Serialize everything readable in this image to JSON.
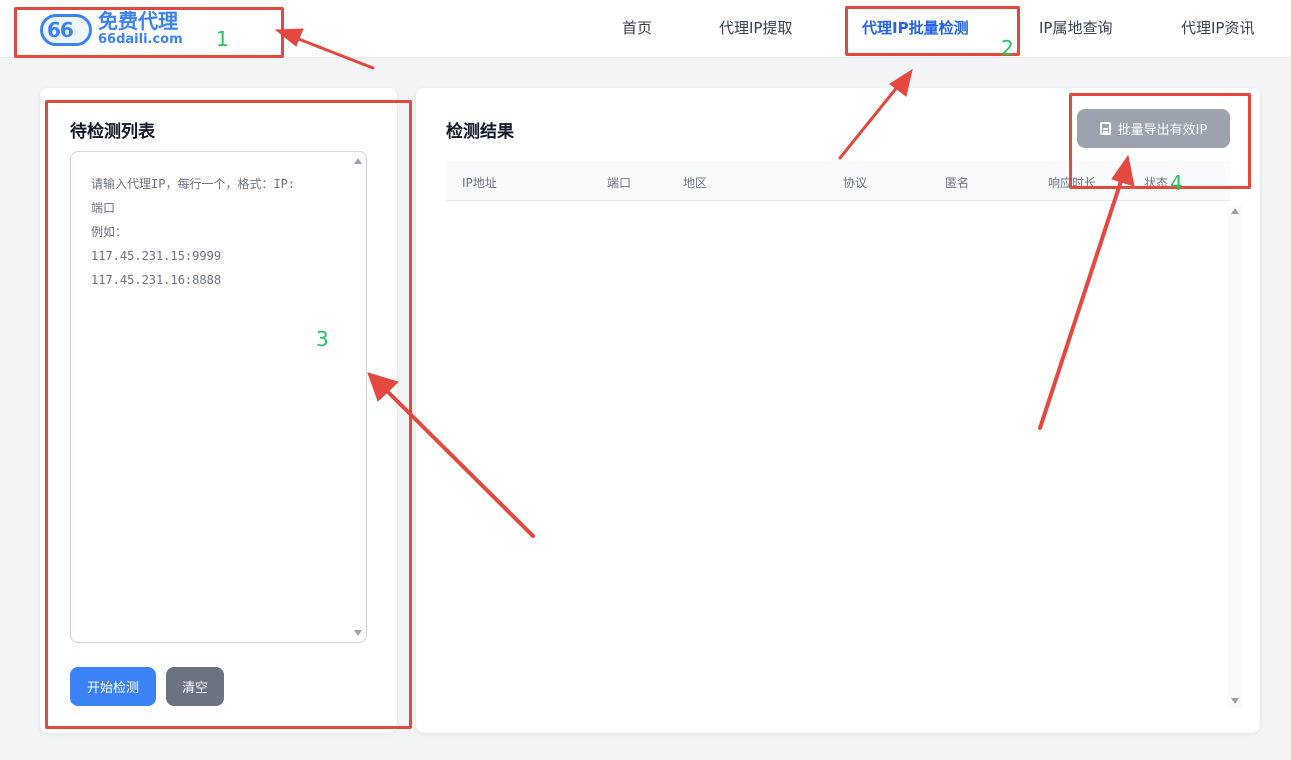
{
  "header": {
    "logo": {
      "mark": "66",
      "title": "免费代理",
      "domain": "66daili.com"
    },
    "nav": [
      {
        "label": "首页",
        "active": false
      },
      {
        "label": "代理IP提取",
        "active": false
      },
      {
        "label": "代理IP批量检测",
        "active": true
      },
      {
        "label": "IP属地查询",
        "active": false
      },
      {
        "label": "代理IP资讯",
        "active": false
      }
    ]
  },
  "left_panel": {
    "title": "待检测列表",
    "textarea": {
      "value": "",
      "placeholder": "请输入代理IP，每行一个，格式：IP:\n端口\n例如：\n117.45.231.15:9999\n117.45.231.16:8888"
    },
    "start_button": "开始检测",
    "clear_button": "清空"
  },
  "right_panel": {
    "title": "检测结果",
    "export_button": "批量导出有效IP",
    "columns": [
      "IP地址",
      "端口",
      "地区",
      "协议",
      "匿名",
      "响应时长",
      "状态"
    ],
    "rows": []
  },
  "annotations": {
    "labels": [
      "1",
      "2",
      "3",
      "4"
    ],
    "color": "#e5483f",
    "label_color": "#22c55e"
  },
  "colors": {
    "accent": "#3b82f6",
    "active_nav": "#2563eb",
    "secondary_button": "#6b7280",
    "disabled_button": "#9ca3af"
  }
}
